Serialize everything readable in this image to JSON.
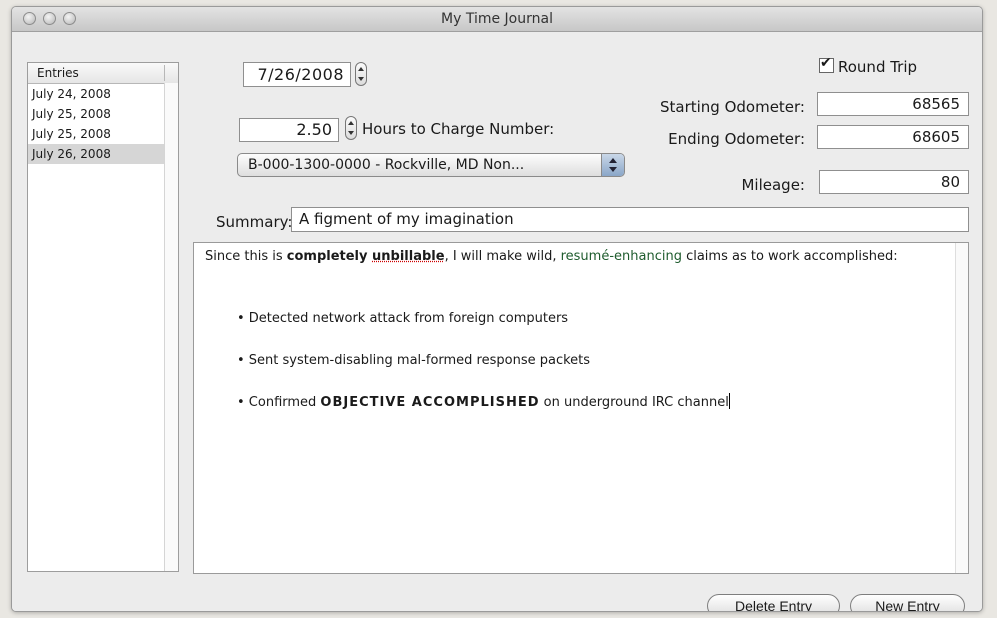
{
  "window": {
    "title": "My Time Journal"
  },
  "entries": {
    "header": "Entries",
    "items": [
      "July 24, 2008",
      "July 25, 2008",
      "July 25, 2008",
      "July 26, 2008"
    ],
    "selected_index": 3
  },
  "form": {
    "date": "7/26/2008",
    "hours": "2.50",
    "hours_label": "Hours to Charge Number:",
    "charge_number": "B-000-1300-0000 - Rockville, MD Non...",
    "round_trip_label": "Round Trip",
    "round_trip_checked": true,
    "starting_odometer_label": "Starting Odometer:",
    "starting_odometer": "68565",
    "ending_odometer_label": "Ending Odometer:",
    "ending_odometer": "68605",
    "mileage_label": "Mileage:",
    "mileage": "80",
    "summary_label": "Summary:",
    "summary": "A figment of my imagination"
  },
  "notes": {
    "intro_1": "Since this is ",
    "intro_bold": "completely ",
    "intro_bold_underlined": "unbillable",
    "intro_2": ", I will make wild, ",
    "intro_green": "resumé-enhancing",
    "intro_3": " claims as to work accomplished:",
    "bullets": [
      {
        "text": "• Detected network attack from foreign computers"
      },
      {
        "pre": "• Sent system-disabling ",
        "underlined": "mal",
        "post": "-formed response packets"
      },
      {
        "pre": "• Confirmed ",
        "caps": "OBJECTIVE ACCOMPLISHED",
        "post": " on underground IRC channel"
      }
    ]
  },
  "buttons": {
    "delete": "Delete Entry",
    "new": "New Entry"
  }
}
